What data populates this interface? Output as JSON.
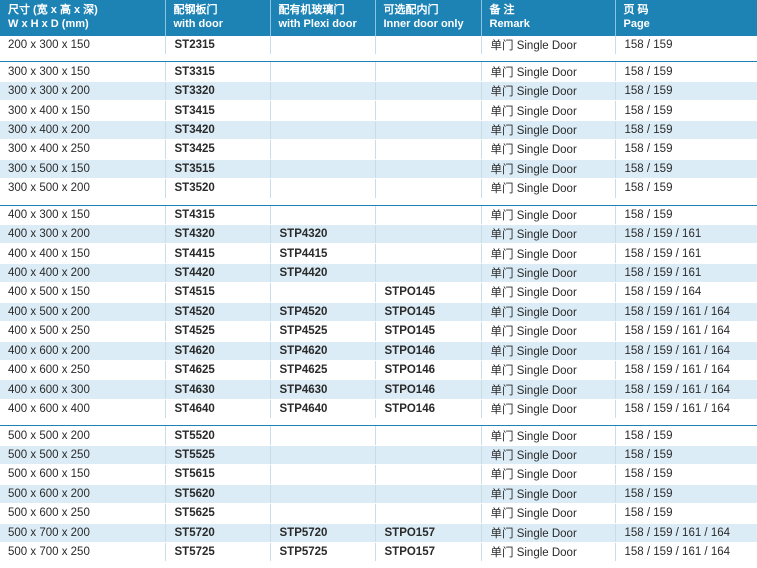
{
  "header": {
    "size": [
      "尺寸 (宽 x 高 x 深)",
      "W x H x D (mm)"
    ],
    "steel": [
      "配钢板门",
      "with door"
    ],
    "plexi": [
      "配有机玻璃门",
      "with Plexi door"
    ],
    "inner": [
      "可选配内门",
      "Inner door only"
    ],
    "remark": [
      "备 注",
      "Remark"
    ],
    "page": [
      "页 码",
      "Page"
    ]
  },
  "groups": [
    [
      {
        "size": "200 x 300 x 150",
        "steel": "ST2315",
        "plexi": "",
        "inner": "",
        "remark": "单门 Single Door",
        "page": "158 / 159"
      }
    ],
    [
      {
        "size": "300 x 300 x 150",
        "steel": "ST3315",
        "plexi": "",
        "inner": "",
        "remark": "单门 Single Door",
        "page": "158 / 159"
      },
      {
        "size": "300 x 300 x 200",
        "steel": "ST3320",
        "plexi": "",
        "inner": "",
        "remark": "单门 Single Door",
        "page": "158 / 159"
      },
      {
        "size": "300 x 400 x 150",
        "steel": "ST3415",
        "plexi": "",
        "inner": "",
        "remark": "单门 Single Door",
        "page": "158 / 159"
      },
      {
        "size": "300 x 400 x 200",
        "steel": "ST3420",
        "plexi": "",
        "inner": "",
        "remark": "单门 Single Door",
        "page": "158 / 159"
      },
      {
        "size": "300 x 400 x 250",
        "steel": "ST3425",
        "plexi": "",
        "inner": "",
        "remark": "单门 Single Door",
        "page": "158 / 159"
      },
      {
        "size": "300 x 500 x 150",
        "steel": "ST3515",
        "plexi": "",
        "inner": "",
        "remark": "单门 Single Door",
        "page": "158 / 159"
      },
      {
        "size": "300 x 500 x 200",
        "steel": "ST3520",
        "plexi": "",
        "inner": "",
        "remark": "单门 Single Door",
        "page": "158 / 159"
      }
    ],
    [
      {
        "size": "400 x 300 x 150",
        "steel": "ST4315",
        "plexi": "",
        "inner": "",
        "remark": "单门 Single Door",
        "page": "158 / 159"
      },
      {
        "size": "400 x 300 x 200",
        "steel": "ST4320",
        "plexi": "STP4320",
        "inner": "",
        "remark": "单门 Single Door",
        "page": "158 / 159 / 161"
      },
      {
        "size": "400 x 400 x 150",
        "steel": "ST4415",
        "plexi": "STP4415",
        "inner": "",
        "remark": "单门 Single Door",
        "page": "158 / 159 / 161"
      },
      {
        "size": "400 x 400 x 200",
        "steel": "ST4420",
        "plexi": "STP4420",
        "inner": "",
        "remark": "单门 Single Door",
        "page": "158 / 159 / 161"
      },
      {
        "size": "400 x 500 x 150",
        "steel": "ST4515",
        "plexi": "",
        "inner": "STPO145",
        "remark": "单门 Single Door",
        "page": "158 / 159 / 164"
      },
      {
        "size": "400 x 500 x 200",
        "steel": "ST4520",
        "plexi": "STP4520",
        "inner": "STPO145",
        "remark": "单门 Single Door",
        "page": "158 / 159 / 161 / 164"
      },
      {
        "size": "400 x 500 x 250",
        "steel": "ST4525",
        "plexi": "STP4525",
        "inner": "STPO145",
        "remark": "单门 Single Door",
        "page": "158 / 159 / 161 / 164"
      },
      {
        "size": "400 x 600 x 200",
        "steel": "ST4620",
        "plexi": "STP4620",
        "inner": "STPO146",
        "remark": "单门 Single Door",
        "page": "158 / 159 / 161 / 164"
      },
      {
        "size": "400 x 600 x 250",
        "steel": "ST4625",
        "plexi": "STP4625",
        "inner": "STPO146",
        "remark": "单门 Single Door",
        "page": "158 / 159 / 161 / 164"
      },
      {
        "size": "400 x 600 x 300",
        "steel": "ST4630",
        "plexi": "STP4630",
        "inner": "STPO146",
        "remark": "单门 Single Door",
        "page": "158 / 159 / 161 / 164"
      },
      {
        "size": "400 x 600 x 400",
        "steel": "ST4640",
        "plexi": "STP4640",
        "inner": "STPO146",
        "remark": "单门 Single Door",
        "page": "158 / 159 / 161 / 164"
      }
    ],
    [
      {
        "size": "500 x 500 x 200",
        "steel": "ST5520",
        "plexi": "",
        "inner": "",
        "remark": "单门 Single Door",
        "page": "158 / 159"
      },
      {
        "size": "500 x 500 x 250",
        "steel": "ST5525",
        "plexi": "",
        "inner": "",
        "remark": "单门 Single Door",
        "page": "158 / 159"
      },
      {
        "size": "500 x 600 x 150",
        "steel": "ST5615",
        "plexi": "",
        "inner": "",
        "remark": "单门 Single Door",
        "page": "158 / 159"
      },
      {
        "size": "500 x 600 x 200",
        "steel": "ST5620",
        "plexi": "",
        "inner": "",
        "remark": "单门 Single Door",
        "page": "158 / 159"
      },
      {
        "size": "500 x 600 x 250",
        "steel": "ST5625",
        "plexi": "",
        "inner": "",
        "remark": "单门 Single Door",
        "page": "158 / 159"
      },
      {
        "size": "500 x 700 x 200",
        "steel": "ST5720",
        "plexi": "STP5720",
        "inner": "STPO157",
        "remark": "单门 Single Door",
        "page": "158 / 159 / 161 / 164"
      },
      {
        "size": "500 x 700 x 250",
        "steel": "ST5725",
        "plexi": "STP5725",
        "inner": "STPO157",
        "remark": "单门 Single Door",
        "page": "158 / 159 / 161 / 164"
      }
    ]
  ],
  "colors": {
    "header_bg": "#1d83b5",
    "alt_row_bg": "#dbecf6",
    "text": "#2a2a2a"
  }
}
